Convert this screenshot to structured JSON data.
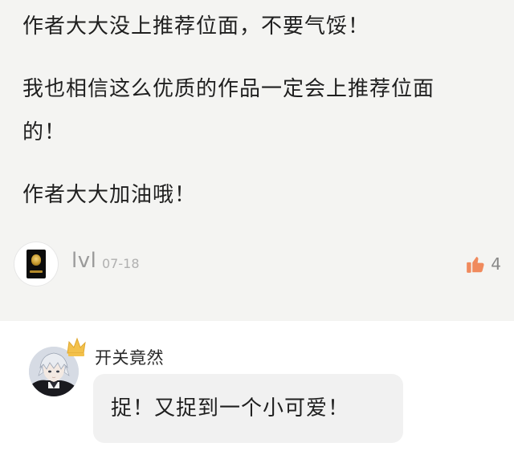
{
  "comment": {
    "paragraphs": [
      "作者大大没上推荐位面，不要气馁！",
      "我也相信这么优质的作品一定会上推荐位面",
      "的！",
      "作者大大加油哦！"
    ],
    "author": "lvl",
    "date": "07-18",
    "like_count": "4",
    "like_icon": "thumbs-up-icon",
    "like_color": "#f08a5d"
  },
  "reply": {
    "author": "开关竟然",
    "text": "捉！又捉到一个小可爱！",
    "badge_icon": "crown-icon",
    "badge_color": "#f3c14b"
  }
}
